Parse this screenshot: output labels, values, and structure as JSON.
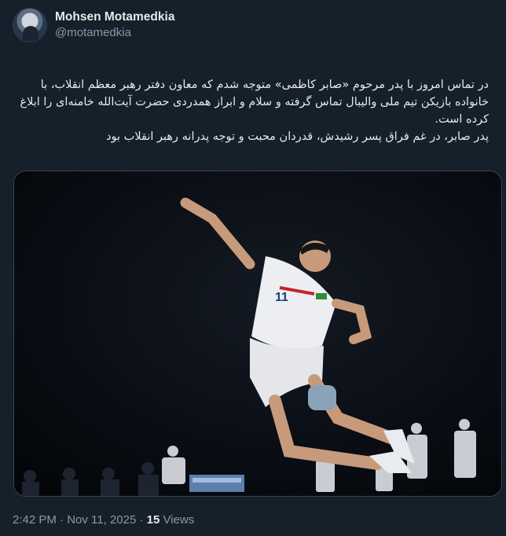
{
  "author": {
    "display_name": "Mohsen Motamedkia",
    "handle": "@motamedkia"
  },
  "tweet": {
    "paragraphs": [
      "در تماس امروز با پدر مرحوم «صابر کاظمی» متوجه شدم که معاون دفتر رهبر معظم انقلاب، با خانواده بازیکن تیم ملی والیبال تماس گرفته و سلام و ابراز همدردی حضرت آیت‌الله خامنه‌ای را ابلاغ کرده است.",
      "پدر صابر، در غم فراق پسر رشیدش، قدردان محبت و توجه پدرانه رهبر انقلاب بود"
    ]
  },
  "media": {
    "jersey_number": "11"
  },
  "meta": {
    "timestamp": "2:42 PM · Nov 11, 2025 · ",
    "views_count": "15",
    "views_label": " Views"
  }
}
